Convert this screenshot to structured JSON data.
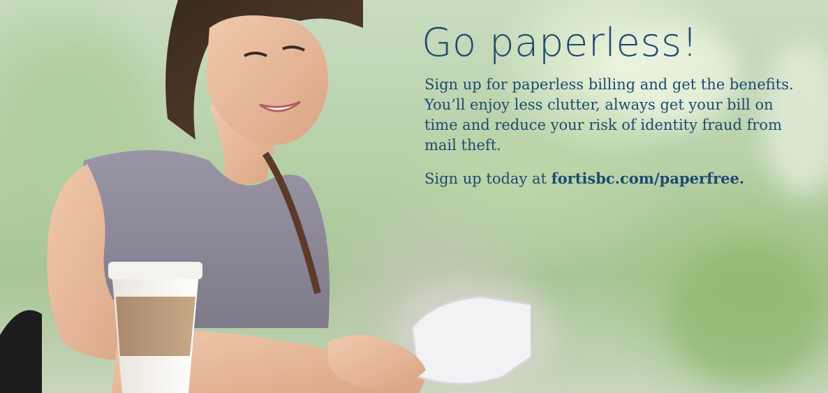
{
  "promo": {
    "headline": "Go paperless!",
    "body": "Sign up for paperless billing and get the benefits. You’ll enjoy less clutter, always get your bill on time and reduce your risk of identity fraud from mail theft.",
    "cta_prefix": "Sign up today at ",
    "cta_link": "fortisbc.com/paperfree."
  },
  "colors": {
    "text": "#1e4a70",
    "headline": "#1f4a6e"
  }
}
